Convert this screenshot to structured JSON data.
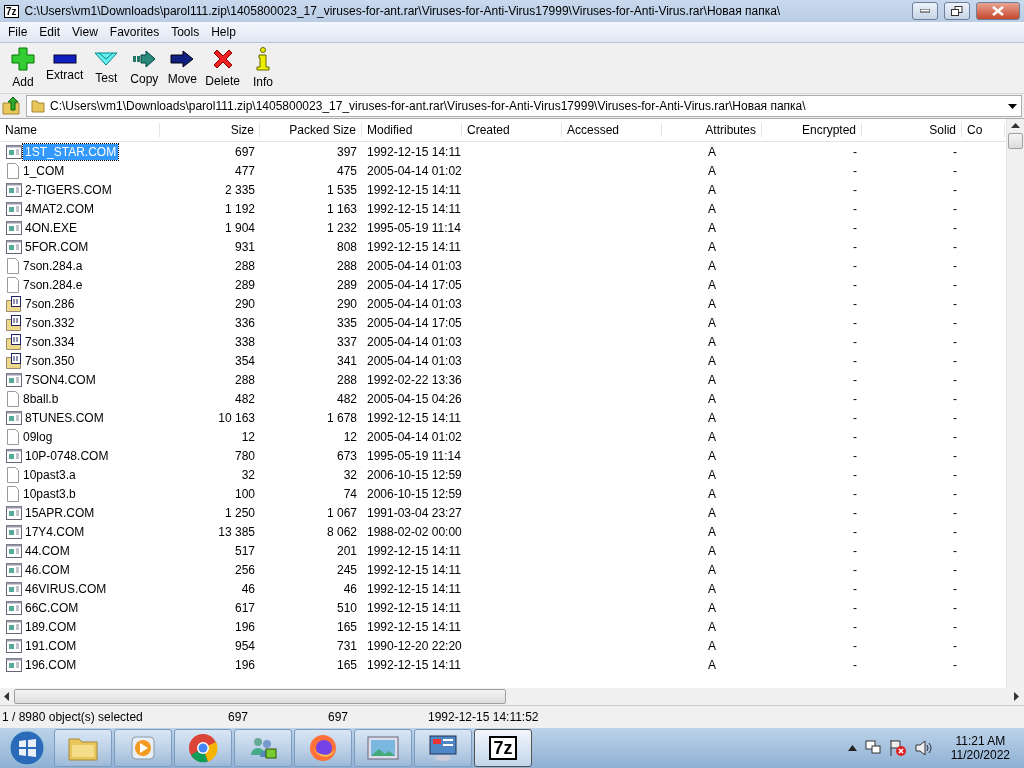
{
  "window": {
    "app_icon_label": "7z",
    "title": "C:\\Users\\vm1\\Downloads\\parol111.zip\\1405800023_17_viruses-for-ant.rar\\Viruses-for-Anti-Virus17999\\Viruses-for-Anti-Virus.rar\\Новая папка\\"
  },
  "menu": [
    "File",
    "Edit",
    "View",
    "Favorites",
    "Tools",
    "Help"
  ],
  "toolbar": [
    {
      "kind": "add",
      "label": "Add"
    },
    {
      "kind": "extract",
      "label": "Extract"
    },
    {
      "kind": "test",
      "label": "Test"
    },
    {
      "kind": "copy",
      "label": "Copy"
    },
    {
      "kind": "move",
      "label": "Move"
    },
    {
      "kind": "delete",
      "label": "Delete"
    },
    {
      "kind": "info",
      "label": "Info"
    }
  ],
  "address": {
    "value": "C:\\Users\\vm1\\Downloads\\parol111.zip\\1405800023_17_viruses-for-ant.rar\\Viruses-for-Anti-Virus17999\\Viruses-for-Anti-Virus.rar\\Новая папка\\"
  },
  "table": {
    "columns": [
      "Name",
      "Size",
      "Packed Size",
      "Modified",
      "Created",
      "Accessed",
      "Attributes",
      "Encrypted",
      "Solid",
      "Co"
    ],
    "rows": [
      {
        "kind": "program",
        "name": "1ST_STAR.COM",
        "size": "697",
        "packed_size": "397",
        "modified": "1992-12-15 14:11",
        "attributes": "A",
        "encrypted": "-",
        "solid": "-",
        "selected": true
      },
      {
        "kind": "file",
        "name": "1_COM",
        "size": "477",
        "packed_size": "475",
        "modified": "2005-04-14 01:02",
        "attributes": "A",
        "encrypted": "-",
        "solid": "-",
        "selected": false
      },
      {
        "kind": "program",
        "name": "2-TIGERS.COM",
        "size": "2 335",
        "packed_size": "1 535",
        "modified": "1992-12-15 14:11",
        "attributes": "A",
        "encrypted": "-",
        "solid": "-",
        "selected": false
      },
      {
        "kind": "program",
        "name": "4MAT2.COM",
        "size": "1 192",
        "packed_size": "1 163",
        "modified": "1992-12-15 14:11",
        "attributes": "A",
        "encrypted": "-",
        "solid": "-",
        "selected": false
      },
      {
        "kind": "program",
        "name": "4ON.EXE",
        "size": "1 904",
        "packed_size": "1 232",
        "modified": "1995-05-19 11:14",
        "attributes": "A",
        "encrypted": "-",
        "solid": "-",
        "selected": false
      },
      {
        "kind": "program",
        "name": "5FOR.COM",
        "size": "931",
        "packed_size": "808",
        "modified": "1992-12-15 14:11",
        "attributes": "A",
        "encrypted": "-",
        "solid": "-",
        "selected": false
      },
      {
        "kind": "file",
        "name": "7son.284.a",
        "size": "288",
        "packed_size": "288",
        "modified": "2005-04-14 01:03",
        "attributes": "A",
        "encrypted": "-",
        "solid": "-",
        "selected": false
      },
      {
        "kind": "file",
        "name": "7son.284.e",
        "size": "289",
        "packed_size": "289",
        "modified": "2005-04-14 17:05",
        "attributes": "A",
        "encrypted": "-",
        "solid": "-",
        "selected": false
      },
      {
        "kind": "binary",
        "name": "7son.286",
        "size": "290",
        "packed_size": "290",
        "modified": "2005-04-14 01:03",
        "attributes": "A",
        "encrypted": "-",
        "solid": "-",
        "selected": false
      },
      {
        "kind": "binary",
        "name": "7son.332",
        "size": "336",
        "packed_size": "335",
        "modified": "2005-04-14 17:05",
        "attributes": "A",
        "encrypted": "-",
        "solid": "-",
        "selected": false
      },
      {
        "kind": "binary",
        "name": "7son.334",
        "size": "338",
        "packed_size": "337",
        "modified": "2005-04-14 01:03",
        "attributes": "A",
        "encrypted": "-",
        "solid": "-",
        "selected": false
      },
      {
        "kind": "binary",
        "name": "7son.350",
        "size": "354",
        "packed_size": "341",
        "modified": "2005-04-14 01:03",
        "attributes": "A",
        "encrypted": "-",
        "solid": "-",
        "selected": false
      },
      {
        "kind": "program",
        "name": "7SON4.COM",
        "size": "288",
        "packed_size": "288",
        "modified": "1992-02-22 13:36",
        "attributes": "A",
        "encrypted": "-",
        "solid": "-",
        "selected": false
      },
      {
        "kind": "file",
        "name": "8ball.b",
        "size": "482",
        "packed_size": "482",
        "modified": "2005-04-15 04:26",
        "attributes": "A",
        "encrypted": "-",
        "solid": "-",
        "selected": false
      },
      {
        "kind": "program",
        "name": "8TUNES.COM",
        "size": "10 163",
        "packed_size": "1 678",
        "modified": "1992-12-15 14:11",
        "attributes": "A",
        "encrypted": "-",
        "solid": "-",
        "selected": false
      },
      {
        "kind": "file",
        "name": "09log",
        "size": "12",
        "packed_size": "12",
        "modified": "2005-04-14 01:02",
        "attributes": "A",
        "encrypted": "-",
        "solid": "-",
        "selected": false
      },
      {
        "kind": "program",
        "name": "10P-0748.COM",
        "size": "780",
        "packed_size": "673",
        "modified": "1995-05-19 11:14",
        "attributes": "A",
        "encrypted": "-",
        "solid": "-",
        "selected": false
      },
      {
        "kind": "file",
        "name": "10past3.a",
        "size": "32",
        "packed_size": "32",
        "modified": "2006-10-15 12:59",
        "attributes": "A",
        "encrypted": "-",
        "solid": "-",
        "selected": false
      },
      {
        "kind": "file",
        "name": "10past3.b",
        "size": "100",
        "packed_size": "74",
        "modified": "2006-10-15 12:59",
        "attributes": "A",
        "encrypted": "-",
        "solid": "-",
        "selected": false
      },
      {
        "kind": "program",
        "name": "15APR.COM",
        "size": "1 250",
        "packed_size": "1 067",
        "modified": "1991-03-04 23:27",
        "attributes": "A",
        "encrypted": "-",
        "solid": "-",
        "selected": false
      },
      {
        "kind": "program",
        "name": "17Y4.COM",
        "size": "13 385",
        "packed_size": "8 062",
        "modified": "1988-02-02 00:00",
        "attributes": "A",
        "encrypted": "-",
        "solid": "-",
        "selected": false
      },
      {
        "kind": "program",
        "name": "44.COM",
        "size": "517",
        "packed_size": "201",
        "modified": "1992-12-15 14:11",
        "attributes": "A",
        "encrypted": "-",
        "solid": "-",
        "selected": false
      },
      {
        "kind": "program",
        "name": "46.COM",
        "size": "256",
        "packed_size": "245",
        "modified": "1992-12-15 14:11",
        "attributes": "A",
        "encrypted": "-",
        "solid": "-",
        "selected": false
      },
      {
        "kind": "program",
        "name": "46VIRUS.COM",
        "size": "46",
        "packed_size": "46",
        "modified": "1992-12-15 14:11",
        "attributes": "A",
        "encrypted": "-",
        "solid": "-",
        "selected": false
      },
      {
        "kind": "program",
        "name": "66C.COM",
        "size": "617",
        "packed_size": "510",
        "modified": "1992-12-15 14:11",
        "attributes": "A",
        "encrypted": "-",
        "solid": "-",
        "selected": false
      },
      {
        "kind": "program",
        "name": "189.COM",
        "size": "196",
        "packed_size": "165",
        "modified": "1992-12-15 14:11",
        "attributes": "A",
        "encrypted": "-",
        "solid": "-",
        "selected": false
      },
      {
        "kind": "program",
        "name": "191.COM",
        "size": "954",
        "packed_size": "731",
        "modified": "1990-12-20 22:20",
        "attributes": "A",
        "encrypted": "-",
        "solid": "-",
        "selected": false
      },
      {
        "kind": "program",
        "name": "196.COM",
        "size": "196",
        "packed_size": "165",
        "modified": "1992-12-15 14:11",
        "attributes": "A",
        "encrypted": "-",
        "solid": "-",
        "selected": false
      }
    ]
  },
  "status_bar": [
    "1 / 8980 object(s) selected",
    "697",
    "697",
    "1992-12-15 14:11:52"
  ],
  "taskbar": {
    "apps": [
      {
        "kind": "folder",
        "selected": false
      },
      {
        "kind": "media",
        "selected": false
      },
      {
        "kind": "browser",
        "selected": false
      },
      {
        "kind": "people",
        "selected": false
      },
      {
        "kind": "firefox",
        "selected": false
      },
      {
        "kind": "photo",
        "selected": false
      },
      {
        "kind": "panel",
        "selected": false
      },
      {
        "kind": "sevenzip",
        "label": "7z",
        "selected": true
      }
    ],
    "time": "11:21 AM",
    "date": "11/20/2022"
  }
}
